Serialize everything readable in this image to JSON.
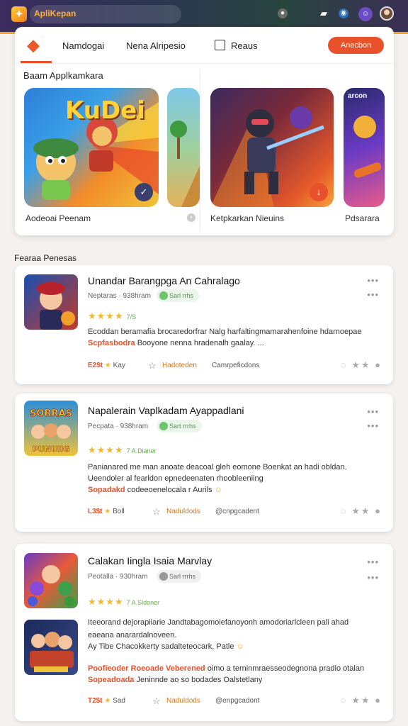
{
  "app": {
    "title": "ApliKepan",
    "logo_icon": "puzzle-app-icon",
    "accent": "#e8512a"
  },
  "topbar": {
    "icons": [
      "notification-icon",
      "bookmark-icon",
      "globe-icon",
      "profile-icon"
    ]
  },
  "nav": {
    "tabs": [
      "Namdogai",
      "Nena Alripesio"
    ],
    "checkbox_label": "Reaus",
    "button_label": "Anecbon"
  },
  "featured": {
    "title": "Baam Applkamkara",
    "items": [
      {
        "label": "Aodeoai Peenam",
        "art_title": "KuDei",
        "badge_icon": "chevron-down-icon",
        "badge_color": "#3b3f6e"
      },
      {
        "label": "",
        "art_title": "",
        "badge_icon": "",
        "badge_color": ""
      },
      {
        "label": "Ketpkarkan Nieuins",
        "art_title": "",
        "badge_icon": "download-icon",
        "badge_color": "#e8512a"
      },
      {
        "label": "Pdsarara",
        "art_title": "arcon",
        "badge_icon": "",
        "badge_color": ""
      }
    ]
  },
  "list": {
    "title": "Fearaa Penesas",
    "items": [
      {
        "name": "Unandar Barangpga An Cahralago",
        "meta": "Neptaras · 938hram",
        "status": "Sarl rrhs",
        "rating_note": "7/S",
        "desc_line1": "Ecoddan beramafia brocaredorfrar Nalg harfaltingmamarahenfoine hdarnoepae",
        "desc_hl": "Scpfasbodra",
        "desc_line2": "Booyone nenna hradenalh gaalay. ...",
        "price": "E2$t",
        "star_label": "Kay",
        "share_label": "Hadoteden",
        "ext_label": "Camrpeficdons"
      },
      {
        "name": "Napalerain Vaplkadam Ayappadlani",
        "meta": "Pecpata · 938hram",
        "status": "Sart rrrhs",
        "rating_note": "7 A.Dianer",
        "desc_line1": "Panianared me man anoate deacoal gleh eomone Boenkat an hadi obldan.",
        "desc_line2": "Ueendoler al fearldon epnedeenaten rhoobleeniing",
        "desc_hl": "Sopadakd",
        "desc_line3": "codeeoenelocala r Aurils",
        "price": "L3$t",
        "star_label": "Boll",
        "share_label": "Naduldods",
        "ext_label": "@cnpgcadent"
      },
      {
        "name": "Calakan Iingla Isaia Marvlay",
        "meta": "Peotalla · 930hram",
        "status": "Sarl rrrhs",
        "rating_note": "7 A.Sldoner",
        "desc_line1": "Iteeorand dejorapiiarie Jandtabagomoiefanoyonh amodoriarlcleen pali ahad",
        "desc_line2": "eaeana anarardalnoveen.",
        "desc_line3": "Ay Tibe Chacokkerty sadalteteocark, Patle",
        "hl2_a": "Poofieoder Roeoade Veberened",
        "desc_line4": "oimo a terninmraesseodegnona pradio otalan",
        "hl2_b": "Sopeadoada",
        "desc_line5": "Jeninnde ao so bodades Oalstetlany",
        "price": "T2$t",
        "star_label": "Sad",
        "share_label": "Naduldods",
        "ext_label": "@enpgcadont"
      }
    ]
  }
}
